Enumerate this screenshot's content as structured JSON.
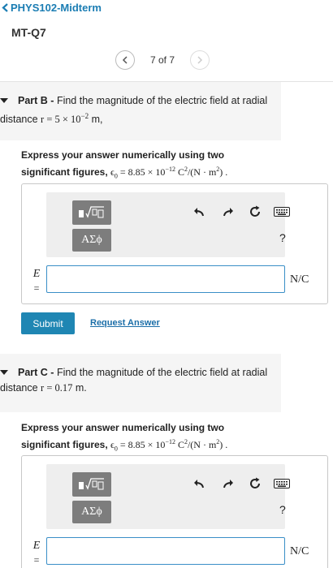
{
  "header": {
    "back_label": "PHYS102-Midterm",
    "question_id": "MT-Q7",
    "pager_text": "7 of 7"
  },
  "partB": {
    "label": "Part B -",
    "prompt_text": "Find the magnitude of the electric field at radial distance",
    "r_value": "r = 5 × 10",
    "r_exp": "−2",
    "r_unit": " m,",
    "instruction_line1": "Express your answer numerically using two",
    "instruction_line2": "significant figures,",
    "eps_text": "ϵ",
    "eps_sub": "0",
    "eps_value": " = 8.85 × 10",
    "eps_exp": "−12",
    "eps_units": " C",
    "eps_units_exp": "2",
    "eps_units_tail": "/(N · m",
    "eps_units_tail_exp": "2",
    "eps_end": ") .",
    "greek_label": "ΑΣϕ",
    "help_label": "?",
    "var": "E",
    "eq": "=",
    "input_value": "",
    "unit": "N/C"
  },
  "actions": {
    "submit": "Submit",
    "request_answer": "Request Answer"
  },
  "partC": {
    "label": "Part C -",
    "prompt_text": "Find the magnitude of the electric field at radial distance",
    "r_value": "r = 0.17",
    "r_unit": " m.",
    "instruction_line1": "Express your answer numerically using two",
    "instruction_line2": "significant figures,",
    "eps_text": "ϵ",
    "eps_sub": "0",
    "eps_value": " = 8.85 × 10",
    "eps_exp": "−12",
    "eps_units": " C",
    "eps_units_exp": "2",
    "eps_units_tail": "/(N · m",
    "eps_units_tail_exp": "2",
    "eps_end": ") .",
    "greek_label": "ΑΣϕ",
    "help_label": "?",
    "var": "E",
    "eq": "=",
    "input_value": "",
    "unit": "N/C"
  },
  "colors": {
    "link": "#1b7db3",
    "submit_bg": "#1f86b3",
    "input_border": "#3a8fc7",
    "toolbar_bg": "#eeeeee",
    "tool_button_bg": "#7d7d7d"
  }
}
